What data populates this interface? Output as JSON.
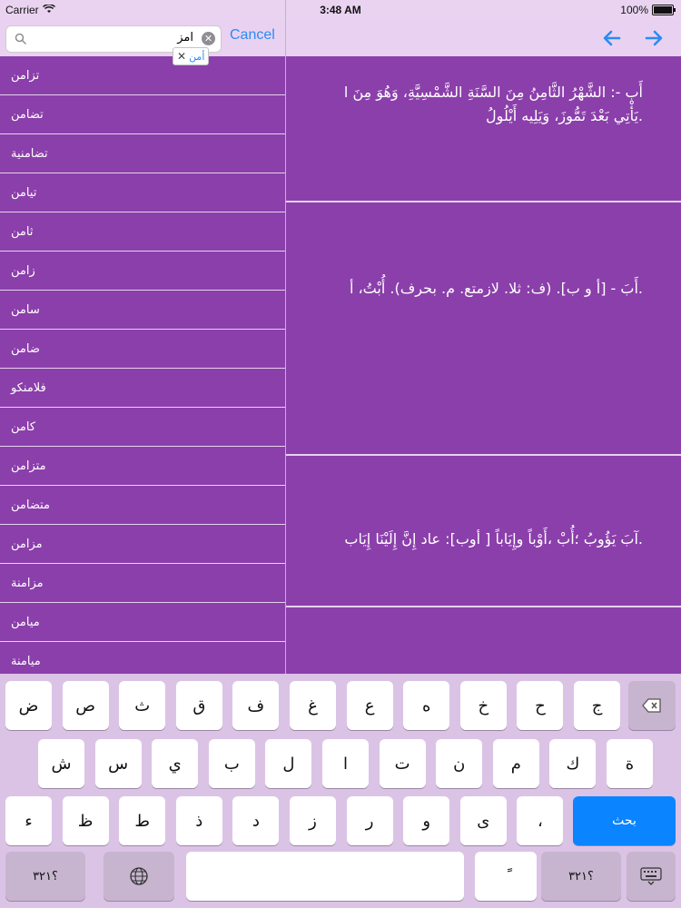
{
  "status": {
    "carrier": "Carrier",
    "time": "3:48 AM",
    "battery": "100%",
    "battery_level": 1.0
  },
  "search": {
    "query": "امز",
    "suggestion": "أمن",
    "cancel_label": "Cancel"
  },
  "results": [
    "تزامن",
    "تضامن",
    "تضامنية",
    "تيامن",
    "ثامن",
    "زامن",
    "سامن",
    "ضامن",
    "فلامنكو",
    "كامن",
    "متزامن",
    "متضامن",
    "مزامن",
    "مزامنة",
    "ميامن",
    "ميامنة"
  ],
  "definitions": [
    {
      "lines": [
        "أَب -: الشَّهْرُ الثَّامِنُ مِنَ السَّنَةِ الشَّمْسِيَّةِ، وَهُوَ مِنَ ا",
        ".يَأْتِي بَعْدَ تَمُّوزَ، وَيَلِيه أَيْلُولُ"
      ]
    },
    {
      "lines": [
        ".أَبَ - [أ و ب]. (ف: ثلا. لازمتع. م. بحرف). أُبْتُ، أ"
      ]
    },
    {
      "lines": [
        ".آبَ يَؤُوبُ ؛أُبْ ،أَوْباً وإِيَاباً [ أوب]: عاد إِنَّ إِلَيْنَا إِيَاب"
      ]
    }
  ],
  "keyboard": {
    "row1": [
      "ض",
      "ص",
      "ث",
      "ق",
      "ف",
      "غ",
      "ع",
      "ه",
      "خ",
      "ح",
      "ج"
    ],
    "row2": [
      "ش",
      "س",
      "ي",
      "ب",
      "ل",
      "ا",
      "ت",
      "ن",
      "م",
      "ك",
      "ة"
    ],
    "row3": [
      "ء",
      "ظ",
      "ط",
      "ذ",
      "د",
      "ز",
      "ر",
      "و",
      "ى",
      "،"
    ],
    "search_label": "بحث",
    "numbers_label": "؟٣٢١",
    "tanween_label": "ً"
  }
}
